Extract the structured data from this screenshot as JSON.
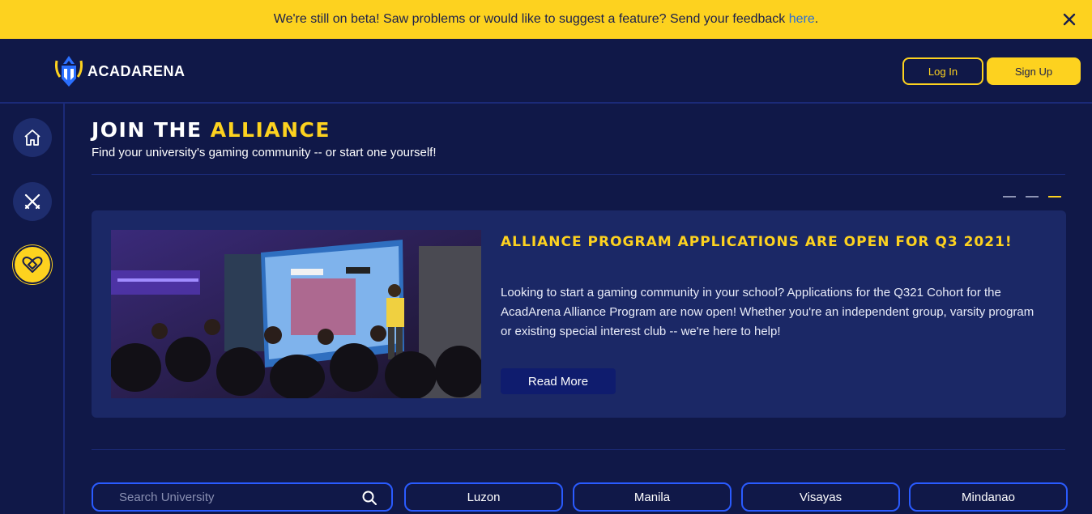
{
  "banner": {
    "text": "We're still on beta! Saw problems or would like to suggest a feature? Send your feedback ",
    "link_text": "here",
    "trailing": "."
  },
  "header": {
    "logo_text": "ACADARENA",
    "login_label": "Log In",
    "signup_label": "Sign Up"
  },
  "sidebar": {
    "items": [
      {
        "icon": "home-icon"
      },
      {
        "icon": "swords-icon"
      },
      {
        "icon": "alliance-heart-icon",
        "active": true
      }
    ]
  },
  "main": {
    "title_prefix": "JOIN THE ",
    "title_accent": "ALLIANCE",
    "subtitle": "Find your university's gaming community -- or start one yourself!",
    "carousel": {
      "slides_count": 3,
      "active_index": 2
    },
    "card": {
      "title": "Alliance Program Applications are open for Q3 2021!",
      "body": "Looking to start a gaming community in your school? Applications for the Q321 Cohort for the AcadArena Alliance Program are now open! Whether you're an independent group, varsity program or existing special interest club -- we're here to help!",
      "button_label": "Read More"
    }
  },
  "filters": {
    "search_placeholder": "Search University",
    "regions": [
      "Luzon",
      "Manila",
      "Visayas",
      "Mindanao"
    ]
  },
  "colors": {
    "accent": "#fdd21f",
    "background": "#101848",
    "card": "#1b2866",
    "outline_blue": "#2a5bff"
  }
}
